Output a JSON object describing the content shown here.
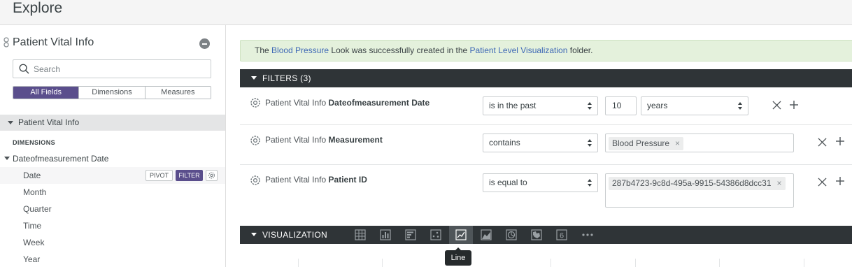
{
  "header": {
    "title": "Explore"
  },
  "sidebar": {
    "explore_name": "Patient Vital Info",
    "search": {
      "placeholder": "Search",
      "value": ""
    },
    "toggle": {
      "all_fields": "All Fields",
      "dimensions": "Dimensions",
      "measures": "Measures",
      "active": "All Fields"
    },
    "view_label": "Patient Vital Info",
    "dimensions_heading": "DIMENSIONS",
    "group_label": "Dateofmeasurement Date",
    "fields": [
      "Date",
      "Month",
      "Quarter",
      "Time",
      "Week",
      "Year"
    ],
    "pivot_label": "PIVOT",
    "filter_label": "FILTER"
  },
  "alert": {
    "prefix": "The",
    "look_name": "Blood Pressure",
    "middle": "Look was successfully created in the",
    "folder_name": "Patient Level Visualization",
    "suffix": "folder."
  },
  "filters": {
    "title": "FILTERS (3)",
    "rows": [
      {
        "view": "Patient Vital Info",
        "field": "Dateofmeasurement Date",
        "operator": "is in the past",
        "value": "10",
        "unit": "years"
      },
      {
        "view": "Patient Vital Info",
        "field": "Measurement",
        "operator": "contains",
        "tag": "Blood Pressure"
      },
      {
        "view": "Patient Vital Info",
        "field": "Patient ID",
        "operator": "is equal to",
        "tag": "287b4723-9c8d-495a-9915-54386d8dcc31"
      }
    ]
  },
  "visualization": {
    "title": "VISUALIZATION",
    "types": [
      "table-icon",
      "column-icon",
      "bar-icon",
      "scatter-icon",
      "line-icon",
      "area-icon",
      "pie-icon",
      "map-icon",
      "single-value-icon",
      "more-icon"
    ],
    "active": "line-icon",
    "single_value_glyph": "6",
    "more_glyph": "•••",
    "tooltip": "Line"
  },
  "colors": {
    "brand": "#5a4e8c",
    "dark_bar": "#2f3437",
    "alert_bg": "#e4f1dc",
    "link": "#3e68b5"
  }
}
